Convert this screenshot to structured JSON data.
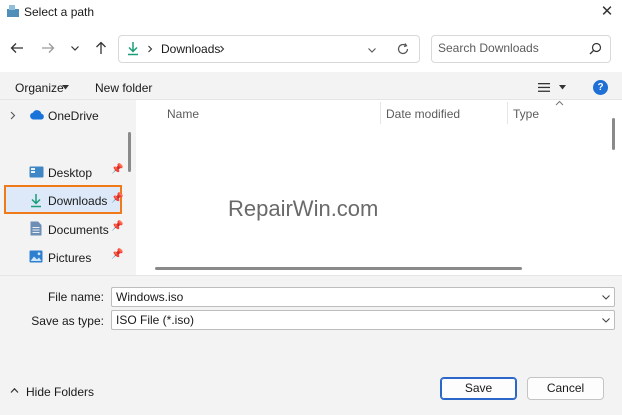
{
  "window": {
    "title": "Select a path"
  },
  "address": {
    "folder": "Downloads"
  },
  "search": {
    "placeholder": "Search Downloads"
  },
  "toolbar": {
    "organize_label": "Organize",
    "new_folder_label": "New folder"
  },
  "navpane": {
    "items": [
      {
        "label": "OneDrive"
      },
      {
        "label": "Desktop"
      },
      {
        "label": "Downloads"
      },
      {
        "label": "Documents"
      },
      {
        "label": "Pictures"
      }
    ]
  },
  "filelist": {
    "columns": [
      "Name",
      "Date modified",
      "Type"
    ]
  },
  "watermark": "RepairWin.com",
  "form": {
    "filename_label": "File name:",
    "filename_value": "Windows.iso",
    "savetype_label": "Save as type:",
    "savetype_value": "ISO File (*.iso)"
  },
  "footer": {
    "hide_folders_label": "Hide Folders",
    "save_label": "Save",
    "cancel_label": "Cancel"
  },
  "colors": {
    "accent": "#1e6fd6",
    "selection_highlight": "#f07a1a",
    "download_green": "#1a9e77"
  }
}
